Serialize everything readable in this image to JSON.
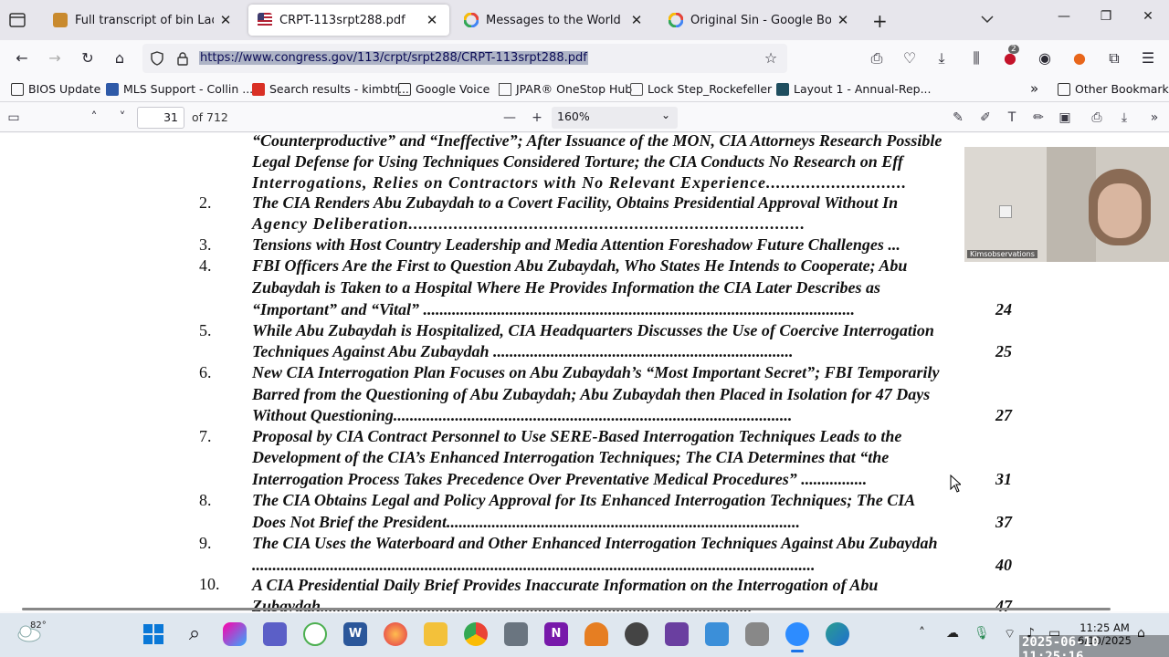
{
  "tabs": [
    {
      "title": "Full transcript of bin Ladin's spe",
      "icon": "archive-icon",
      "active": false
    },
    {
      "title": "CRPT-113srpt288.pdf",
      "icon": "us-flag-icon",
      "active": true
    },
    {
      "title": "Messages to the World - Googl",
      "icon": "google-icon",
      "active": false
    },
    {
      "title": "Original Sin - Google Books",
      "icon": "google-icon",
      "active": false
    }
  ],
  "nav": {
    "url": "https://www.congress.gov/113/crpt/srpt288/CRPT-113srpt288.pdf",
    "extension_badge": "2"
  },
  "bookmarks": [
    {
      "label": "BIOS Update",
      "icon": "folder-icon"
    },
    {
      "label": "MLS Support - Collin ...",
      "icon": "mls-icon"
    },
    {
      "label": "Search results - kimbtr...",
      "icon": "gmail-icon"
    },
    {
      "label": "Google Voice",
      "icon": "folder-icon"
    },
    {
      "label": "JPAR® OneStop Hub",
      "icon": "page-icon"
    },
    {
      "label": "Lock Step_Rockefeller ...",
      "icon": "lock-icon"
    },
    {
      "label": "Layout 1 - Annual-Rep...",
      "icon": "r-icon"
    }
  ],
  "other_bookmarks": "Other Bookmarks",
  "pdf_toolbar": {
    "page": "31",
    "page_count": "of 712",
    "zoom": "160%"
  },
  "toc": [
    {
      "num": "",
      "lines": [
        "“Counterproductive” and “Ineffective”; After Issuance of the MON, CIA Attorneys Research Possible",
        "Legal Defense for Using Techniques Considered Torture; the CIA Conducts No Research on Eff",
        "Interrogations, Relies on Contractors with No Relevant Experience............................"
      ],
      "page": ""
    },
    {
      "num": "2.",
      "lines": [
        "The CIA Renders Abu Zubaydah to a Covert Facility, Obtains Presidential Approval Without In",
        "Agency Deliberation..............................................................................."
      ],
      "page": ""
    },
    {
      "num": "3.",
      "lines": [
        "Tensions with Host Country Leadership and Media Attention Foreshadow Future Challenges ..."
      ],
      "page": ""
    },
    {
      "num": "4.",
      "lines": [
        "FBI Officers Are the First to Question Abu Zubaydah, Who States He Intends to Cooperate; Abu",
        "Zubaydah is Taken to a Hospital Where He Provides Information the CIA Later Describes as",
        "“Important” and “Vital” ........................................................................................................."
      ],
      "page": "24"
    },
    {
      "num": "5.",
      "lines": [
        "While Abu Zubaydah is Hospitalized, CIA Headquarters Discusses the Use of Coercive Interrogation",
        "Techniques Against Abu Zubaydah ........................................................................."
      ],
      "page": "25"
    },
    {
      "num": "6.",
      "lines": [
        "New CIA Interrogation Plan Focuses on Abu Zubaydah’s “Most Important Secret”; FBI Temporarily",
        "Barred from the Questioning of Abu Zubaydah; Abu Zubaydah then Placed in Isolation for 47 Days",
        "Without Questioning................................................................................................."
      ],
      "page": "27"
    },
    {
      "num": "7.",
      "lines": [
        "Proposal by CIA Contract Personnel to Use SERE-Based Interrogation Techniques Leads to the",
        "Development of the CIA’s Enhanced Interrogation Techniques; The CIA Determines that “the",
        "Interrogation Process Takes Precedence Over Preventative Medical Procedures” ................"
      ],
      "page": "31"
    },
    {
      "num": "8.",
      "lines": [
        "The CIA Obtains Legal and Policy Approval for Its Enhanced Interrogation Techniques; The CIA",
        "Does Not Brief the President......................................................................................"
      ],
      "page": "37"
    },
    {
      "num": "9.",
      "lines": [
        "The CIA Uses the Waterboard and Other Enhanced Interrogation Techniques Against Abu Zubaydah",
        "........................................................................................................................................."
      ],
      "page": "40"
    },
    {
      "num": "10.",
      "lines": [
        "A CIA Presidential Daily Brief Provides Inaccurate Information on the Interrogation of Abu",
        "Zubaydah........................................................................................................."
      ],
      "page": "47"
    }
  ],
  "webcam": {
    "label": "Kimsobservations"
  },
  "taskbar": {
    "temperature": "82°",
    "time": "11:25 AM",
    "date": "6/10/2025",
    "timestamp": "2025-06-10 11:25:16"
  }
}
